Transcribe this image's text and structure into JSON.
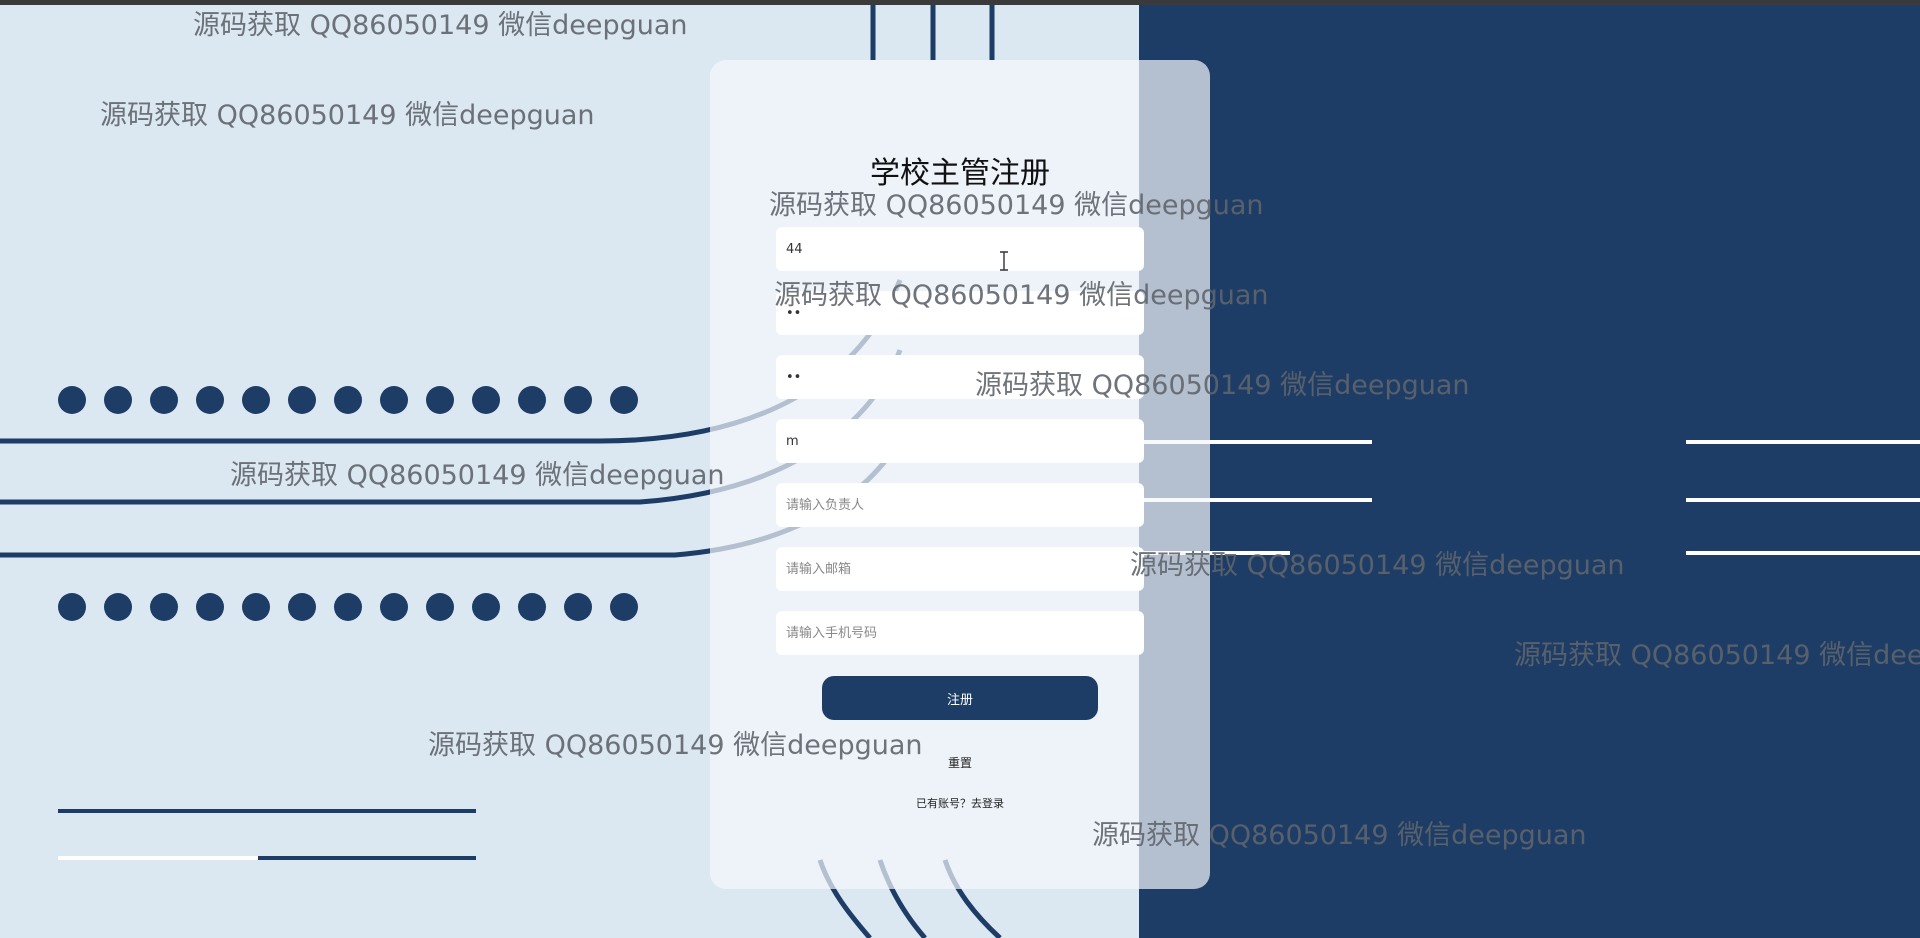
{
  "form": {
    "title": "学校主管注册",
    "fields": [
      {
        "name": "account",
        "type": "text",
        "value": "44",
        "placeholder": ""
      },
      {
        "name": "password",
        "type": "password",
        "value": "11",
        "placeholder": ""
      },
      {
        "name": "confirm-password",
        "type": "password",
        "value": "11",
        "placeholder": ""
      },
      {
        "name": "school-name",
        "type": "text",
        "value": "m",
        "placeholder": ""
      },
      {
        "name": "manager",
        "type": "text",
        "value": "",
        "placeholder": "请输入负责人"
      },
      {
        "name": "email",
        "type": "text",
        "value": "",
        "placeholder": "请输入邮箱"
      },
      {
        "name": "phone",
        "type": "text",
        "value": "",
        "placeholder": "请输入手机号码"
      }
    ],
    "submit_label": "注册",
    "reset_label": "重置",
    "login_prompt": "已有账号？",
    "login_link": "去登录"
  },
  "watermark_text": "源码获取 QQ86050149 微信deepguan",
  "colors": {
    "brand_navy": "#1d3d66",
    "page_background": "#dbe7f1"
  }
}
